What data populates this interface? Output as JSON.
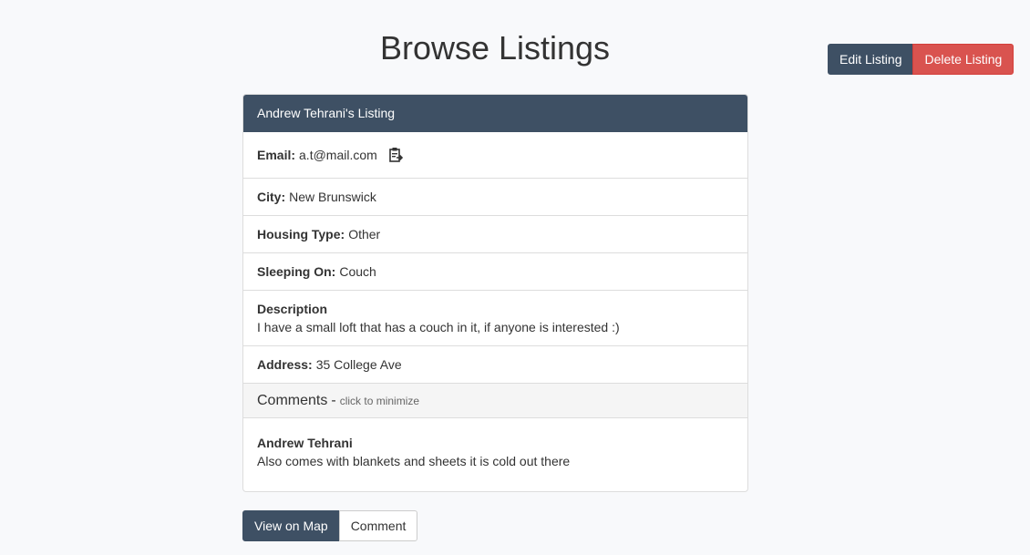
{
  "page": {
    "title": "Browse Listings"
  },
  "actions": {
    "edit_label": "Edit Listing",
    "delete_label": "Delete Listing"
  },
  "listing": {
    "heading": "Andrew Tehrani's Listing",
    "email_label": "Email:",
    "email": "a.t@mail.com",
    "copy_icon": "clipboard-icon",
    "city_label": "City:",
    "city": "New Brunswick",
    "housing_label": "Housing Type:",
    "housing_type": "Other",
    "sleeping_label": "Sleeping On:",
    "sleeping_on": "Couch",
    "description_label": "Description",
    "description": "I have a small loft that has a couch in it, if anyone is interested :)",
    "address_label": "Address:",
    "address": "35 College Ave"
  },
  "comments": {
    "title": "Comments",
    "separator": "-",
    "hint": "click to minimize",
    "items": [
      {
        "author": "Andrew Tehrani",
        "text": "Also comes with blankets and sheets it is cold out there"
      }
    ]
  },
  "bottom": {
    "map_label": "View on Map",
    "comment_label": "Comment"
  },
  "colors": {
    "primary": "#3e5064",
    "danger": "#d9534f",
    "background": "#f8f9fb"
  }
}
